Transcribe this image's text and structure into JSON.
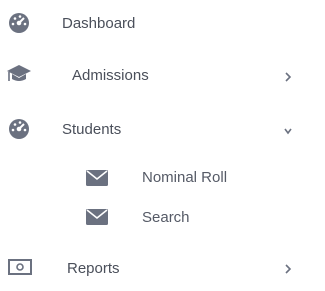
{
  "menu": {
    "items": [
      {
        "label": "Dashboard",
        "icon": "dashboard-gauge-icon"
      },
      {
        "label": "Admissions",
        "icon": "graduation-cap-icon",
        "caret": "chevron-right-icon"
      },
      {
        "label": "Students",
        "icon": "dashboard-gauge-icon",
        "caret": "chevron-down-icon",
        "expanded": true
      },
      {
        "label": "Reports",
        "icon": "money-bill-icon",
        "caret": "chevron-right-icon"
      }
    ],
    "students_sub": [
      {
        "label": "Nominal Roll",
        "icon": "envelope-icon"
      },
      {
        "label": "Search",
        "icon": "envelope-icon"
      }
    ]
  }
}
